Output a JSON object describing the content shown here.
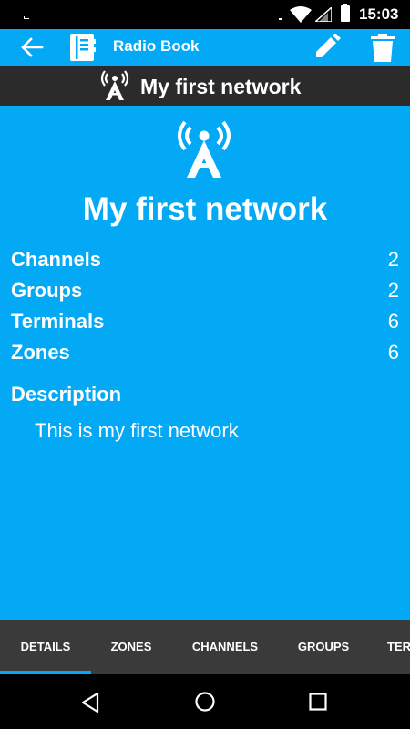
{
  "status_bar": {
    "time": "15:03"
  },
  "app_bar": {
    "title": "Radio Book",
    "icons": [
      "back-arrow-icon",
      "book-icon",
      "edit-pencil-icon",
      "delete-trash-icon"
    ]
  },
  "network": {
    "name": "My first network",
    "icon": "radio-tower-icon"
  },
  "stats": [
    {
      "label": "Channels",
      "value": "2"
    },
    {
      "label": "Groups",
      "value": "2"
    },
    {
      "label": "Terminals",
      "value": "6"
    },
    {
      "label": "Zones",
      "value": "6"
    }
  ],
  "description": {
    "title": "Description",
    "text": "This is my first network"
  },
  "tabs": [
    {
      "label": "DETAILS",
      "selected": true
    },
    {
      "label": "ZONES",
      "selected": false
    },
    {
      "label": "CHANNELS",
      "selected": false
    },
    {
      "label": "GROUPS",
      "selected": false
    },
    {
      "label": "TERMINALS",
      "selected": false
    }
  ],
  "colors": {
    "accent": "#03A9F4",
    "header_dark": "#2b2b2b",
    "tab_bar": "#3a3a3a",
    "status_bar": "#000000"
  }
}
